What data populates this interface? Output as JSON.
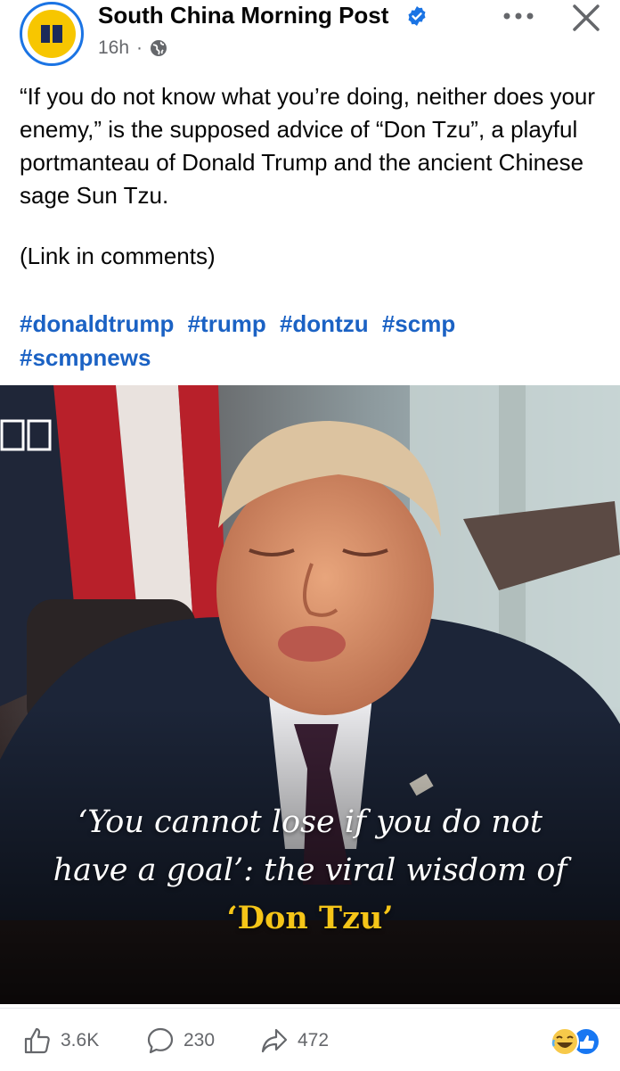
{
  "post": {
    "page_name": "South China Morning Post",
    "timestamp": "16h",
    "separator": "·",
    "text_line1": "“If you do not know what you’re doing, neither does your enemy,” is the supposed advice of “Don Tzu”, a playful portmanteau of Donald Trump and the ancient Chinese sage Sun Tzu.",
    "link_note": "(Link in comments)",
    "hashtags": [
      "#donaldtrump",
      "#trump",
      "#dontzu",
      "#scmp",
      "#scmpnews"
    ]
  },
  "image": {
    "caption_part1": "‘You cannot lose if you do not have a goal’: the viral wisdom of",
    "caption_highlight": "‘Don Tzu’"
  },
  "actions": {
    "likes": "3.6K",
    "comments": "230",
    "shares": "472"
  },
  "icons": {
    "verified": "verified-badge-icon",
    "globe": "globe-icon",
    "more": "more-options-icon",
    "close": "close-icon",
    "like": "thumbs-up-icon",
    "comment": "comment-icon",
    "share": "share-icon"
  },
  "colors": {
    "accent": "#1b74e4",
    "hashtag": "#1b62c4",
    "caption_highlight": "#f5c518",
    "logo_yellow": "#f7c600"
  }
}
